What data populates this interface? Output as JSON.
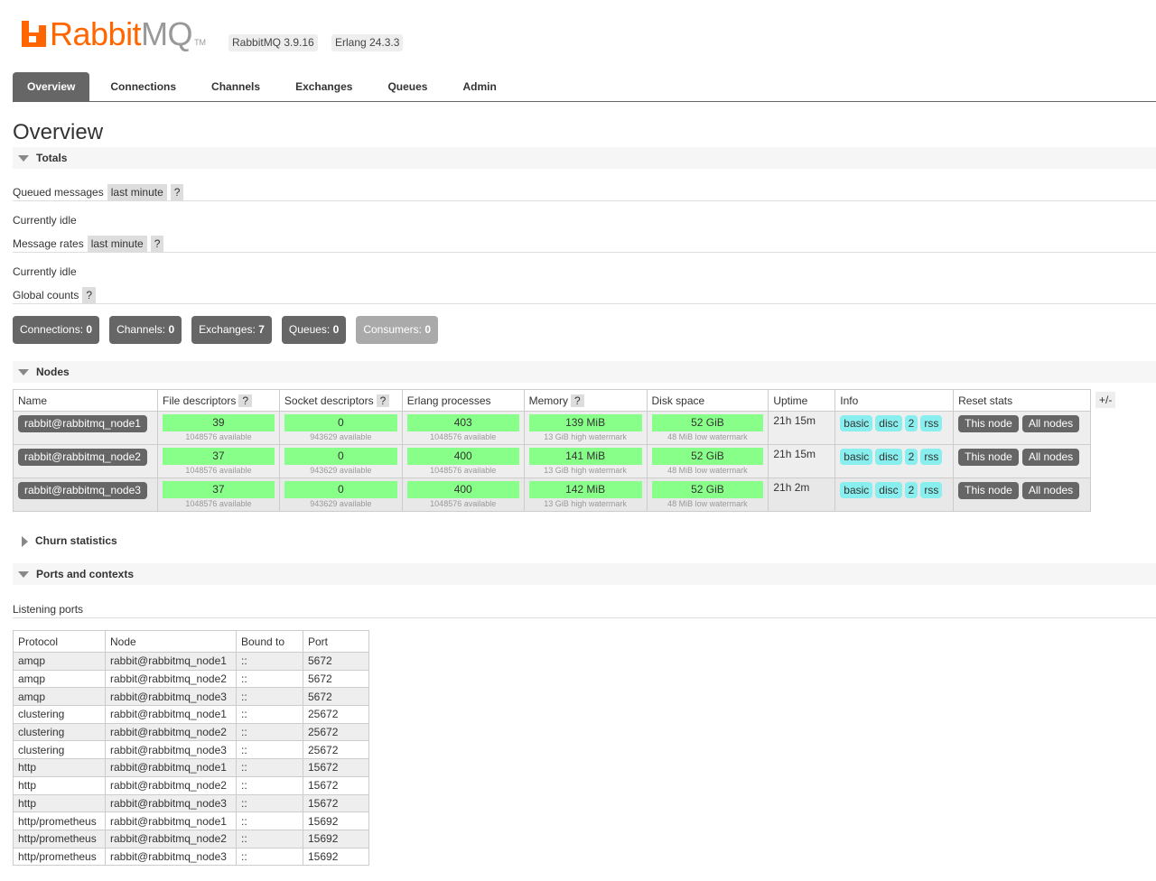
{
  "header": {
    "logo_primary": "Rabbit",
    "logo_secondary": "MQ",
    "logo_tm": "TM",
    "rabbitmq_version": "RabbitMQ 3.9.16",
    "erlang_version": "Erlang 24.3.3"
  },
  "tabs": [
    "Overview",
    "Connections",
    "Channels",
    "Exchanges",
    "Queues",
    "Admin"
  ],
  "page_title": "Overview",
  "totals": {
    "heading": "Totals",
    "queued_label": "Queued messages",
    "queued_range": "last minute",
    "help": "?",
    "queued_status": "Currently idle",
    "rates_label": "Message rates",
    "rates_range": "last minute",
    "rates_status": "Currently idle",
    "global_label": "Global counts",
    "counts": [
      {
        "label": "Connections:",
        "value": "0"
      },
      {
        "label": "Channels:",
        "value": "0"
      },
      {
        "label": "Exchanges:",
        "value": "7"
      },
      {
        "label": "Queues:",
        "value": "0"
      },
      {
        "label": "Consumers:",
        "value": "0"
      }
    ]
  },
  "nodes": {
    "heading": "Nodes",
    "columns": [
      "Name",
      "File descriptors",
      "Socket descriptors",
      "Erlang processes",
      "Memory",
      "Disk space",
      "Uptime",
      "Info",
      "Reset stats"
    ],
    "toggle": "+/-",
    "rows": [
      {
        "name": "rabbit@rabbitmq_node1",
        "fd": "39",
        "fd_sub": "1048576 available",
        "sd": "0",
        "sd_sub": "943629 available",
        "ep": "403",
        "ep_sub": "1048576 available",
        "mem": "139 MiB",
        "mem_sub": "13 GiB high watermark",
        "disk": "52 GiB",
        "disk_sub": "48 MiB low watermark",
        "uptime": "21h 15m",
        "info": [
          "basic",
          "disc",
          "2",
          "rss"
        ],
        "reset": [
          "This node",
          "All nodes"
        ]
      },
      {
        "name": "rabbit@rabbitmq_node2",
        "fd": "37",
        "fd_sub": "1048576 available",
        "sd": "0",
        "sd_sub": "943629 available",
        "ep": "400",
        "ep_sub": "1048576 available",
        "mem": "141 MiB",
        "mem_sub": "13 GiB high watermark",
        "disk": "52 GiB",
        "disk_sub": "48 MiB low watermark",
        "uptime": "21h 15m",
        "info": [
          "basic",
          "disc",
          "2",
          "rss"
        ],
        "reset": [
          "This node",
          "All nodes"
        ]
      },
      {
        "name": "rabbit@rabbitmq_node3",
        "fd": "37",
        "fd_sub": "1048576 available",
        "sd": "0",
        "sd_sub": "943629 available",
        "ep": "400",
        "ep_sub": "1048576 available",
        "mem": "142 MiB",
        "mem_sub": "13 GiB high watermark",
        "disk": "52 GiB",
        "disk_sub": "48 MiB low watermark",
        "uptime": "21h 2m",
        "info": [
          "basic",
          "disc",
          "2",
          "rss"
        ],
        "reset": [
          "This node",
          "All nodes"
        ]
      }
    ]
  },
  "churn": {
    "heading": "Churn statistics"
  },
  "ports": {
    "heading": "Ports and contexts",
    "listening_label": "Listening ports",
    "columns": [
      "Protocol",
      "Node",
      "Bound to",
      "Port"
    ],
    "rows": [
      [
        "amqp",
        "rabbit@rabbitmq_node1",
        "::",
        "5672"
      ],
      [
        "amqp",
        "rabbit@rabbitmq_node2",
        "::",
        "5672"
      ],
      [
        "amqp",
        "rabbit@rabbitmq_node3",
        "::",
        "5672"
      ],
      [
        "clustering",
        "rabbit@rabbitmq_node1",
        "::",
        "25672"
      ],
      [
        "clustering",
        "rabbit@rabbitmq_node2",
        "::",
        "25672"
      ],
      [
        "clustering",
        "rabbit@rabbitmq_node3",
        "::",
        "25672"
      ],
      [
        "http",
        "rabbit@rabbitmq_node1",
        "::",
        "15672"
      ],
      [
        "http",
        "rabbit@rabbitmq_node2",
        "::",
        "15672"
      ],
      [
        "http",
        "rabbit@rabbitmq_node3",
        "::",
        "15672"
      ],
      [
        "http/prometheus",
        "rabbit@rabbitmq_node1",
        "::",
        "15692"
      ],
      [
        "http/prometheus",
        "rabbit@rabbitmq_node2",
        "::",
        "15692"
      ],
      [
        "http/prometheus",
        "rabbit@rabbitmq_node3",
        "::",
        "15692"
      ]
    ]
  },
  "colors": {
    "brand": "#ff6600",
    "bar_green": "#88ff88",
    "tag_cyan": "#88eeee",
    "button_gray": "#666666"
  }
}
